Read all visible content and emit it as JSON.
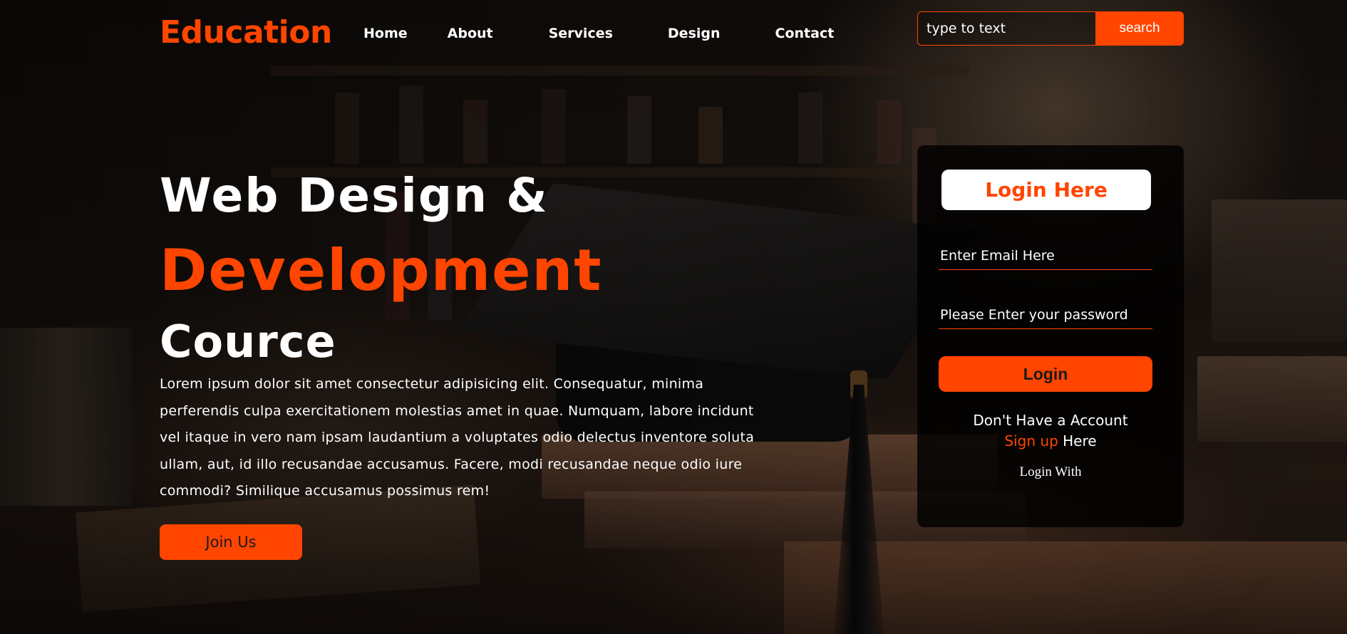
{
  "header": {
    "logo": "Education",
    "nav": [
      "Home",
      "About",
      "Services",
      "Design",
      "Contact"
    ],
    "search": {
      "placeholder": "type to text",
      "button_label": "search"
    }
  },
  "hero": {
    "line1": "Web Design &",
    "line2": "Development",
    "line3": "Cource",
    "paragraph": "Lorem ipsum dolor sit amet consectetur adipisicing elit. Consequatur, minima perferendis culpa exercitationem molestias amet in quae. Numquam, labore incidunt vel itaque in vero nam ipsam laudantium a voluptates odio delectus inventore soluta ullam, aut, id illo recusandae accusamus. Facere, modi recusandae neque odio iure commodi? Similique accusamus possimus rem!",
    "join_label": "Join Us"
  },
  "login": {
    "title": "Login Here",
    "email_placeholder": "Enter Email Here",
    "password_placeholder": "Please Enter your password",
    "button_label": "Login",
    "no_account": "Don't Have a Account",
    "signup_link": "Sign up",
    "signup_suffix": " Here",
    "login_with": "Login With"
  },
  "colors": {
    "accent": "#ff4500",
    "text": "#ffffff",
    "card_bg": "#000000"
  }
}
